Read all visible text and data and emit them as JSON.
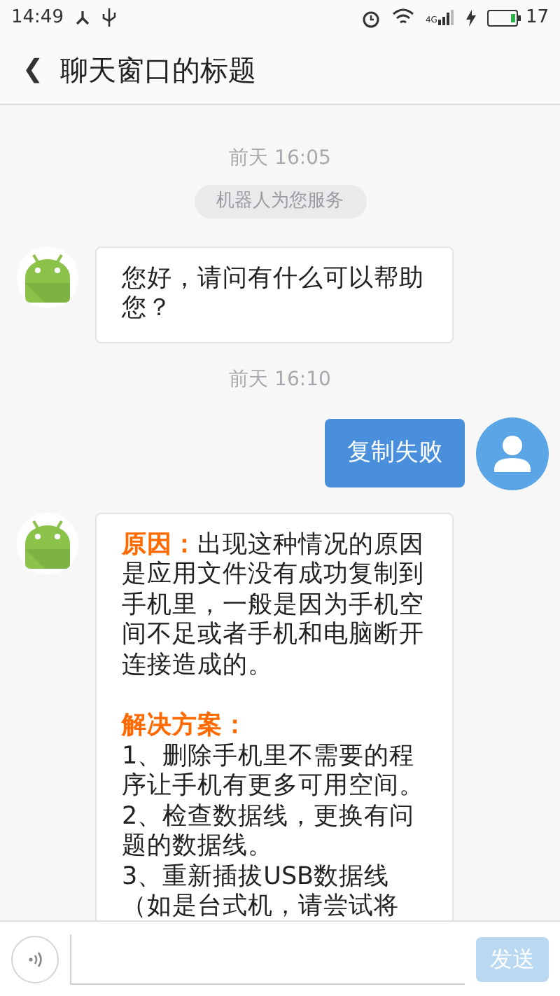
{
  "status_bar": {
    "time": "14:49",
    "network": "4G",
    "battery": "17"
  },
  "header": {
    "back": "❮",
    "title": "聊天窗口的标题"
  },
  "messages": [
    {
      "kind": "time",
      "text": "前天 16:05"
    },
    {
      "kind": "notice",
      "text": "机器人为您服务"
    },
    {
      "kind": "bot",
      "paragraphs": [
        {
          "text": "您好，请问有什么可以帮助您？"
        }
      ]
    },
    {
      "kind": "time",
      "text": "前天 16:10"
    },
    {
      "kind": "user",
      "text": "复制失败"
    },
    {
      "kind": "bot",
      "paragraphs": [
        {
          "label": "原因：",
          "text": "出现这种情况的原因是应用文件没有成功复制到手机里，一般是因为手机空间不足或者手机和电脑断开连接造成的。"
        },
        {
          "label": "解决方案：",
          "items": [
            "1、删除手机里不需要的程序让手机有更多可用空间。",
            "2、检查数据线，更换有问题的数据线。",
            "3、重新插拔USB数据线（如是台式机，请尝试将"
          ]
        }
      ]
    }
  ],
  "input": {
    "send": "发送",
    "send_disabled": true
  }
}
